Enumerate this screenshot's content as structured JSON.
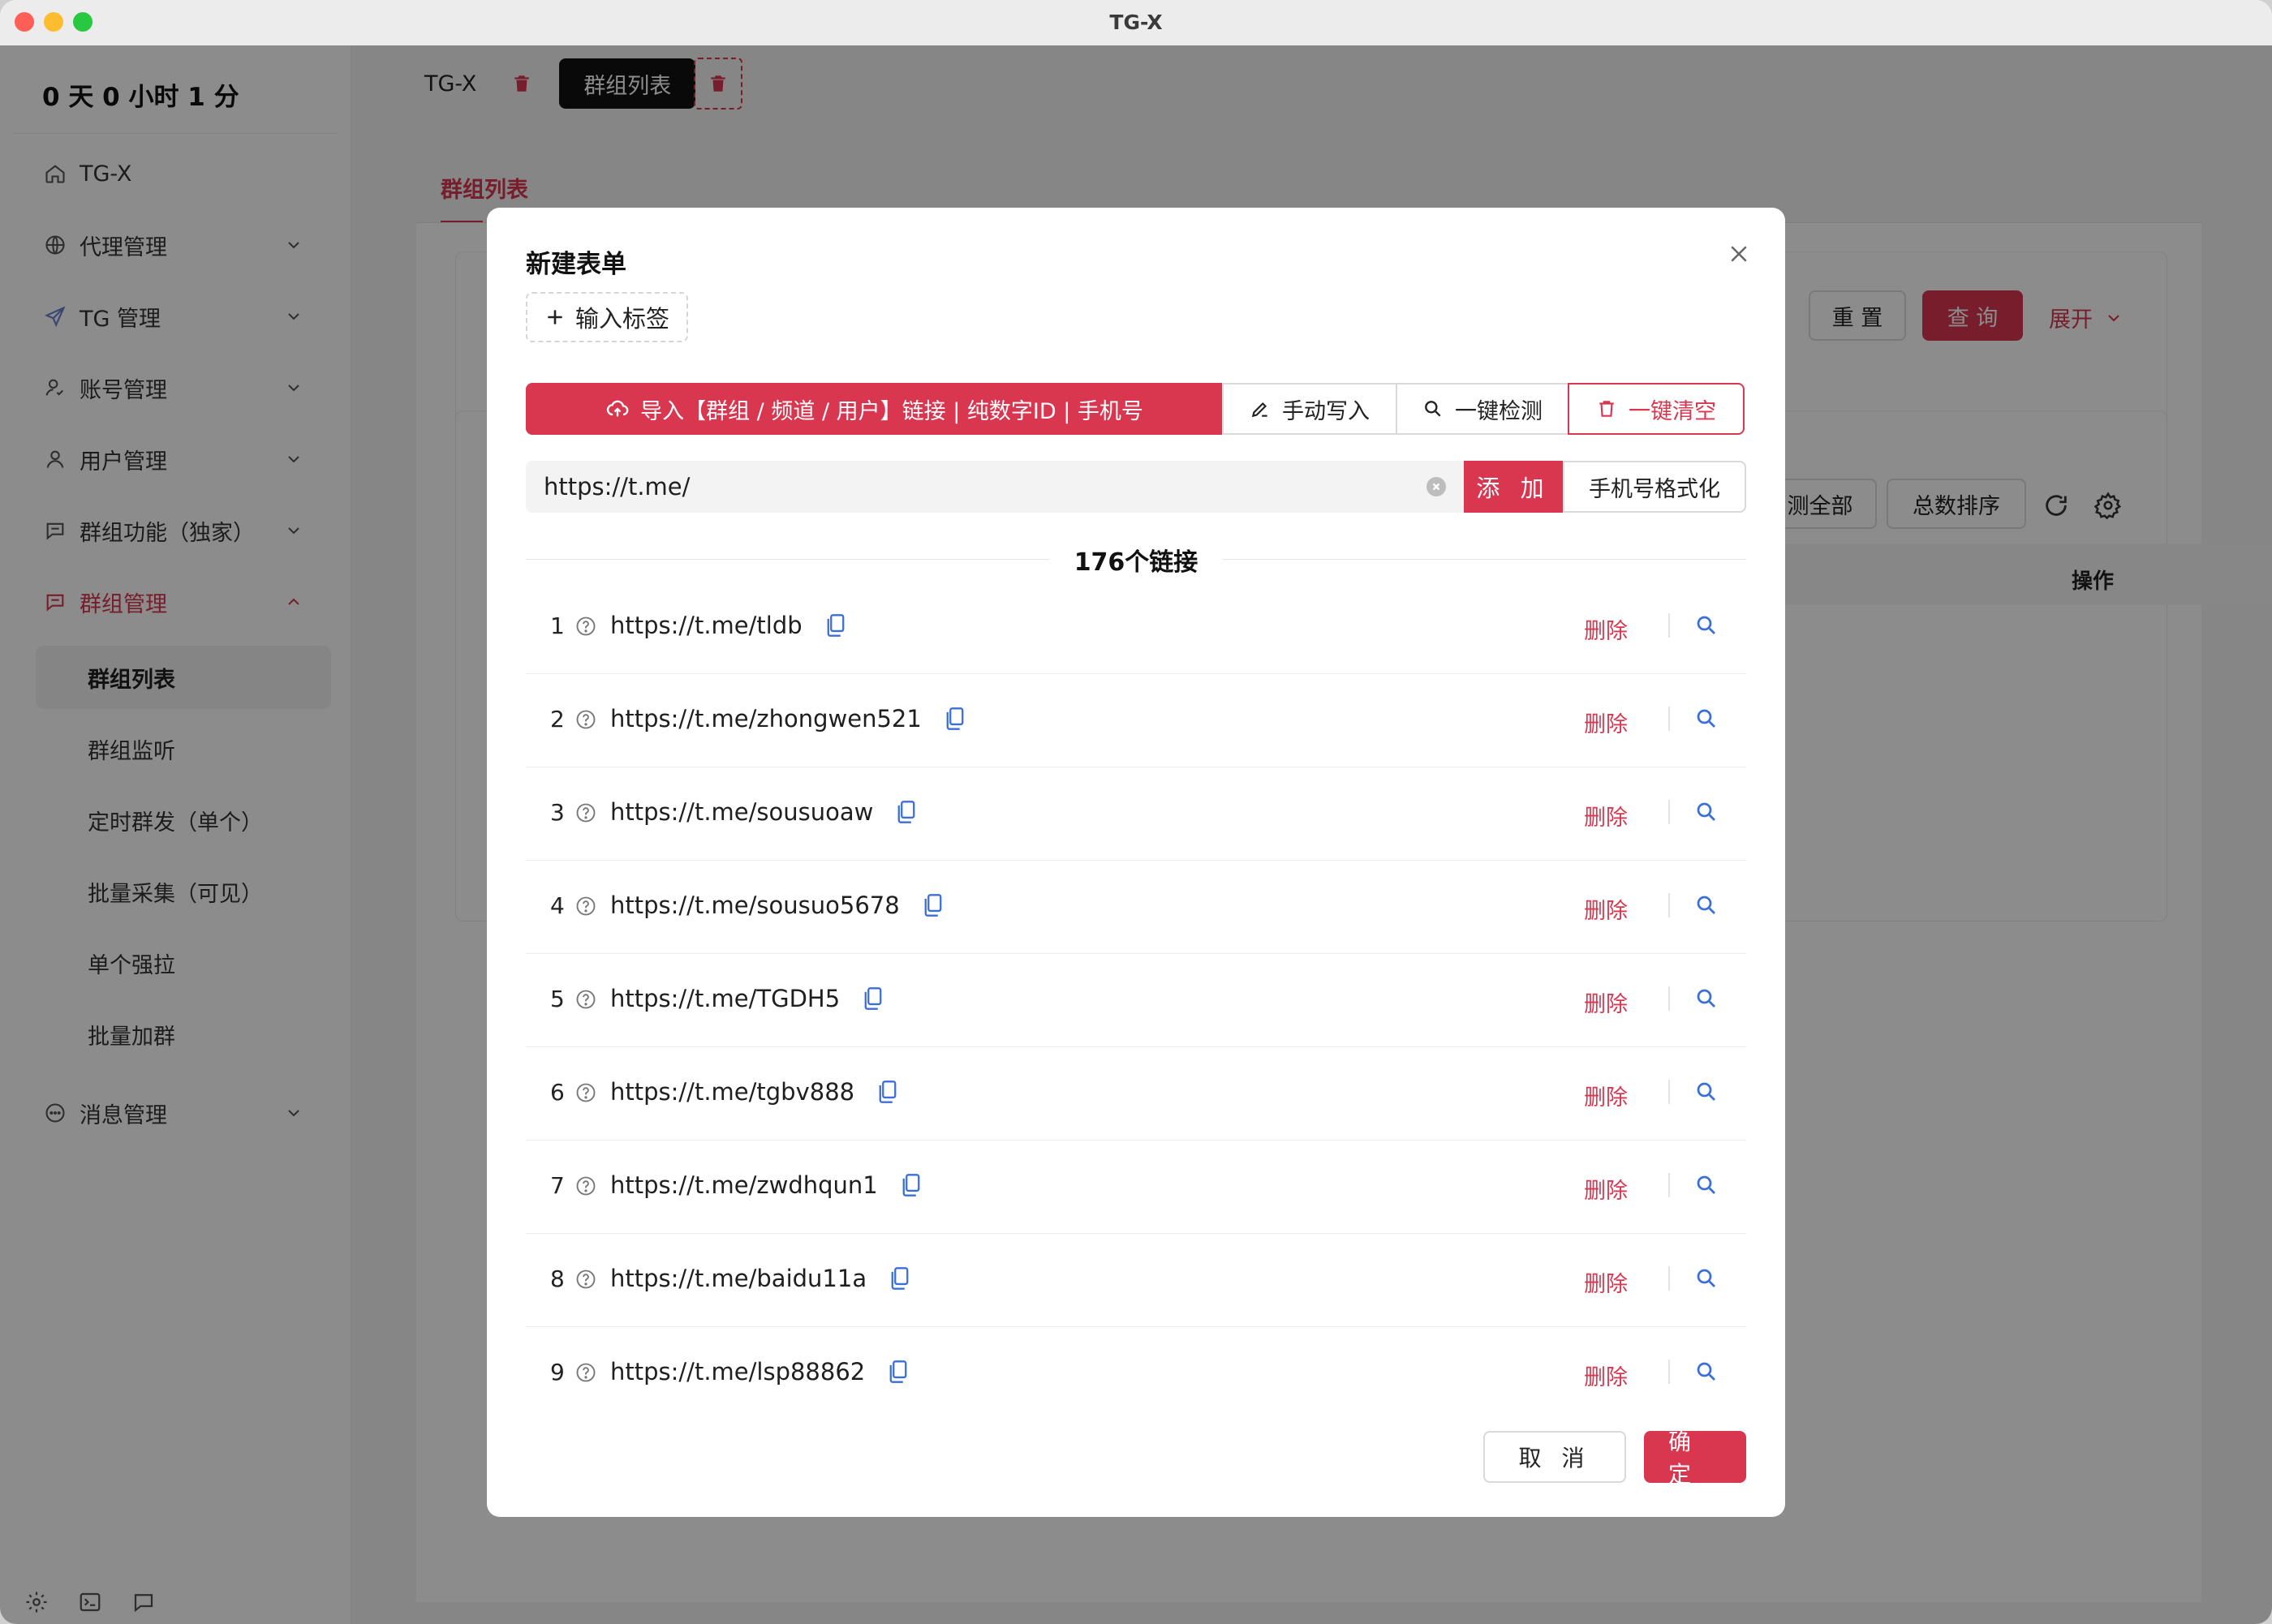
{
  "window": {
    "title": "TG-X"
  },
  "sidebar": {
    "uptime": "0 天 0 小时 1 分",
    "items": [
      {
        "label": "TG-X",
        "icon": "home-icon"
      },
      {
        "label": "代理管理",
        "icon": "globe-icon"
      },
      {
        "label": "TG 管理",
        "icon": "send-icon"
      },
      {
        "label": "账号管理",
        "icon": "account-icon"
      },
      {
        "label": "用户管理",
        "icon": "user-icon"
      },
      {
        "label": "群组功能（独家）",
        "icon": "chat-icon"
      },
      {
        "label": "群组管理",
        "icon": "chat-icon"
      },
      {
        "label": "消息管理",
        "icon": "message-icon"
      }
    ],
    "subitems": [
      "群组列表",
      "群组监听",
      "定时群发（单个）",
      "批量采集（可见）",
      "单个强拉",
      "批量加群"
    ]
  },
  "tabs": {
    "first": "TG-X",
    "active": "群组列表"
  },
  "page": {
    "tab": "群组列表",
    "reset_label": "重 置",
    "query_label": "查 询",
    "expand_label": "展开",
    "check_all_label": "测全部",
    "sort_label": "总数排序",
    "column_action": "操作"
  },
  "modal": {
    "title": "新建表单",
    "tag_button": "输入标签",
    "import_button": "导入【群组 / 频道 / 用户】链接 | 纯数字ID | 手机号",
    "manual_button": "手动写入",
    "check_button": "一键检测",
    "clear_button": "一键清空",
    "url_value": "https://t.me/",
    "add_button": "添 加",
    "phone_format_button": "手机号格式化",
    "count_text": "176个链接",
    "delete_label": "删除",
    "rows": [
      {
        "num": "1",
        "url": "https://t.me/tldb"
      },
      {
        "num": "2",
        "url": "https://t.me/zhongwen521"
      },
      {
        "num": "3",
        "url": "https://t.me/sousuoaw"
      },
      {
        "num": "4",
        "url": "https://t.me/sousuo5678"
      },
      {
        "num": "5",
        "url": "https://t.me/TGDH5"
      },
      {
        "num": "6",
        "url": "https://t.me/tgbv888"
      },
      {
        "num": "7",
        "url": "https://t.me/zwdhqun1"
      },
      {
        "num": "8",
        "url": "https://t.me/baidu11a"
      },
      {
        "num": "9",
        "url": "https://t.me/lsp88862"
      }
    ],
    "cancel_button": "取 消",
    "ok_button": "确 定"
  },
  "colors": {
    "accent": "#d9364f",
    "dark_tab": "#111111",
    "link_blue": "#3b6fd8"
  }
}
